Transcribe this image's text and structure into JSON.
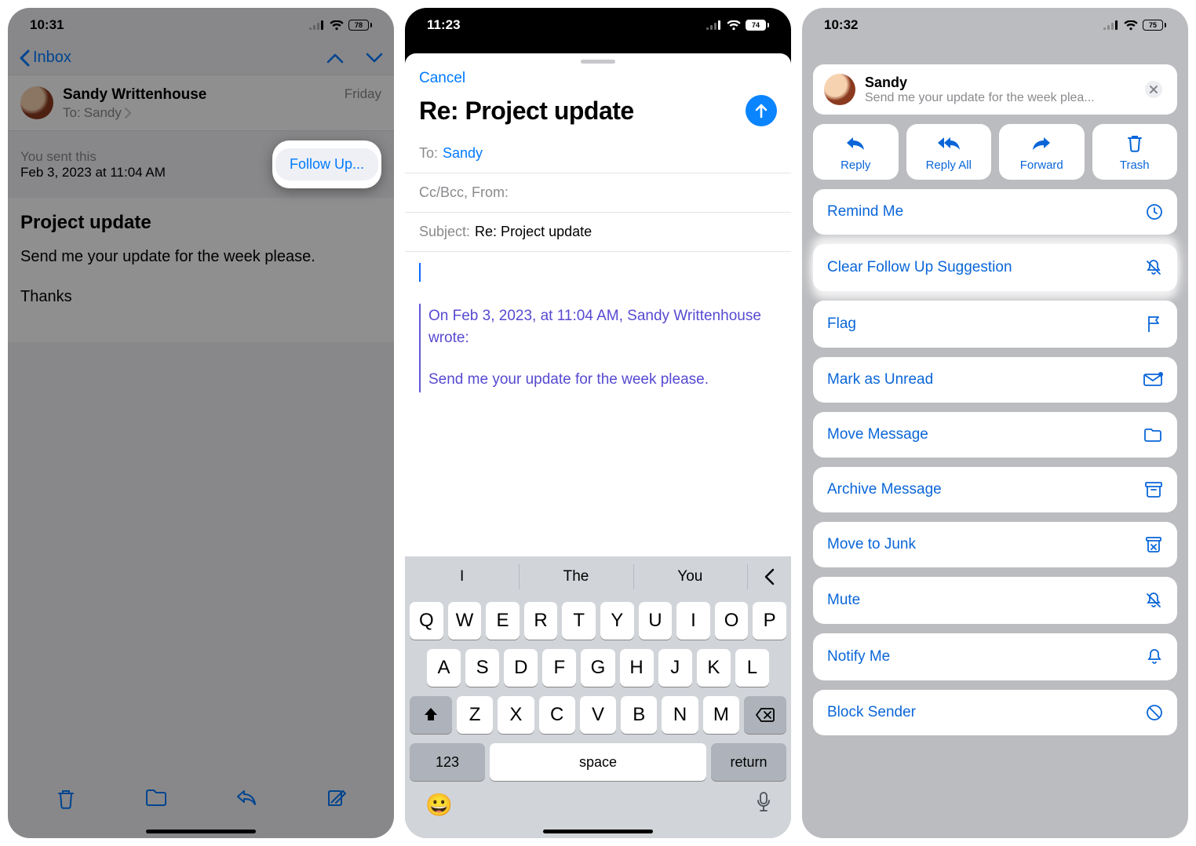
{
  "panel1": {
    "status": {
      "time": "10:31",
      "battery": "78"
    },
    "nav": {
      "back": "Inbox"
    },
    "header": {
      "sender": "Sandy Writtenhouse",
      "to_label": "To:",
      "to_name": "Sandy",
      "date": "Friday"
    },
    "sent_banner": {
      "line1": "You sent this",
      "line2": "Feb 3, 2023 at 11:04 AM",
      "followup": "Follow Up..."
    },
    "body": {
      "subject": "Project update",
      "line1": "Send me your update for the week please.",
      "line2": "Thanks"
    }
  },
  "panel2": {
    "status": {
      "time": "11:23",
      "battery": "74"
    },
    "cancel": "Cancel",
    "title": "Re: Project update",
    "fields": {
      "to_label": "To:",
      "to_value": "Sandy",
      "ccbcc": "Cc/Bcc, From:",
      "subject_label": "Subject:",
      "subject_value": "Re: Project update"
    },
    "quoted": {
      "attribution": "On Feb 3, 2023, at 11:04 AM, Sandy Writtenhouse  wrote:",
      "body": "Send me your update for the week please."
    },
    "keyboard": {
      "suggestions": [
        "I",
        "The",
        "You"
      ],
      "row1": [
        "Q",
        "W",
        "E",
        "R",
        "T",
        "Y",
        "U",
        "I",
        "O",
        "P"
      ],
      "row2": [
        "A",
        "S",
        "D",
        "F",
        "G",
        "H",
        "J",
        "K",
        "L"
      ],
      "row3": [
        "Z",
        "X",
        "C",
        "V",
        "B",
        "N",
        "M"
      ],
      "k123": "123",
      "space": "space",
      "return": "return"
    }
  },
  "panel3": {
    "status": {
      "time": "10:32",
      "battery": "75"
    },
    "header": {
      "name": "Sandy",
      "subtitle": "Send me your update for the week plea..."
    },
    "tiles": [
      {
        "label": "Reply"
      },
      {
        "label": "Reply All"
      },
      {
        "label": "Forward"
      },
      {
        "label": "Trash"
      }
    ],
    "items": [
      {
        "label": "Remind Me",
        "icon": "clock"
      },
      {
        "label": "Clear Follow Up Suggestion",
        "icon": "bell-slash",
        "highlight": true
      },
      {
        "label": "Flag",
        "icon": "flag"
      },
      {
        "label": "Mark as Unread",
        "icon": "envelope"
      },
      {
        "label": "Move Message",
        "icon": "folder"
      },
      {
        "label": "Archive Message",
        "icon": "archive"
      },
      {
        "label": "Move to Junk",
        "icon": "junk"
      },
      {
        "label": "Mute",
        "icon": "bell-slash"
      },
      {
        "label": "Notify Me",
        "icon": "bell"
      },
      {
        "label": "Block Sender",
        "icon": "nosign"
      }
    ]
  }
}
